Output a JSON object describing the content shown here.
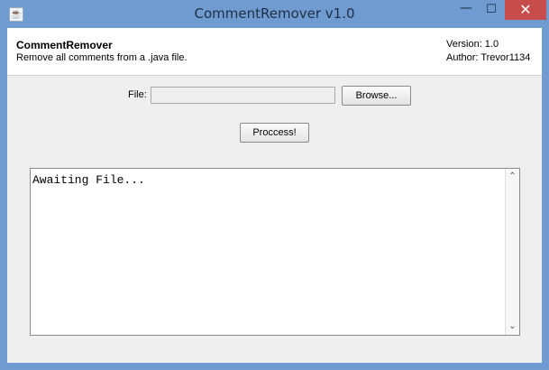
{
  "window": {
    "title": "CommentRemover v1.0",
    "app_icon_glyph": "☕",
    "minimize_glyph": "—",
    "maximize_glyph": "☐",
    "close_glyph": "✕"
  },
  "header": {
    "title": "CommentRemover",
    "description": "Remove all comments from a .java file.",
    "version": "Version: 1.0",
    "author": "Author: Trevor1134"
  },
  "form": {
    "file_label": "File:",
    "file_value": "",
    "browse_label": "Browse...",
    "process_label": "Proccess!"
  },
  "output": {
    "text": "Awaiting File...",
    "scroll_up_glyph": "⌃",
    "scroll_down_glyph": "⌄"
  },
  "colors": {
    "window_frame": "#6f9bd0",
    "close_button": "#c74d4d",
    "client_background": "#efefef"
  }
}
